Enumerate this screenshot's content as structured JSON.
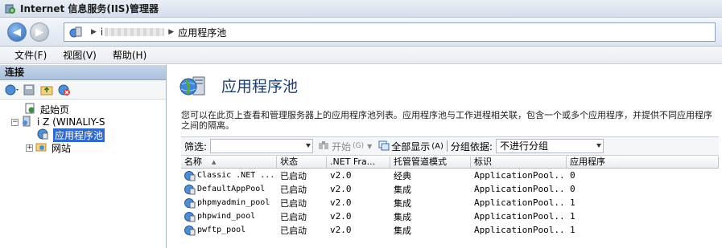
{
  "window": {
    "title": "Internet 信息服务(IIS)管理器"
  },
  "address": {
    "host_prefix": "i",
    "current": "应用程序池"
  },
  "menu": {
    "items": [
      "文件(F)",
      "视图(V)",
      "帮助(H)"
    ]
  },
  "connections": {
    "header": "连接",
    "tree": [
      {
        "label": "起始页"
      },
      {
        "label": "i              Z (WINALIY-S"
      },
      {
        "label": "应用程序池"
      },
      {
        "label": "网站"
      }
    ]
  },
  "main": {
    "title": "应用程序池",
    "description": "您可以在此页上查看和管理服务器上的应用程序池列表。应用程序池与工作进程相关联，包含一个或多个应用程序，并提供不同应用程序之间的隔离。",
    "filter": {
      "label": "筛选:",
      "start_label": "开始",
      "start_hotkey": "(G)",
      "show_all_label": "全部显示",
      "show_all_hotkey": "(A)",
      "group_label": "分组依据:",
      "group_value": "不进行分组"
    },
    "columns": [
      "名称",
      "状态",
      ".NET Fra...",
      "托管管道模式",
      "标识",
      "应用程序"
    ],
    "rows": [
      {
        "name": "Classic .NET ...",
        "state": "已启动",
        "net": "v2.0",
        "pipeline": "经典",
        "identity": "ApplicationPool...",
        "apps": "0"
      },
      {
        "name": "DefaultAppPool",
        "state": "已启动",
        "net": "v2.0",
        "pipeline": "集成",
        "identity": "ApplicationPool...",
        "apps": "0"
      },
      {
        "name": "phpmyadmin_pool",
        "state": "已启动",
        "net": "v2.0",
        "pipeline": "集成",
        "identity": "ApplicationPool...",
        "apps": "1"
      },
      {
        "name": "phpwind_pool",
        "state": "已启动",
        "net": "v2.0",
        "pipeline": "集成",
        "identity": "ApplicationPool...",
        "apps": "1"
      },
      {
        "name": "pwftp_pool",
        "state": "已启动",
        "net": "v2.0",
        "pipeline": "集成",
        "identity": "ApplicationPool...",
        "apps": "1"
      }
    ]
  },
  "colors": {
    "selection": "#3169c6",
    "title_blue": "#1c3f73"
  }
}
